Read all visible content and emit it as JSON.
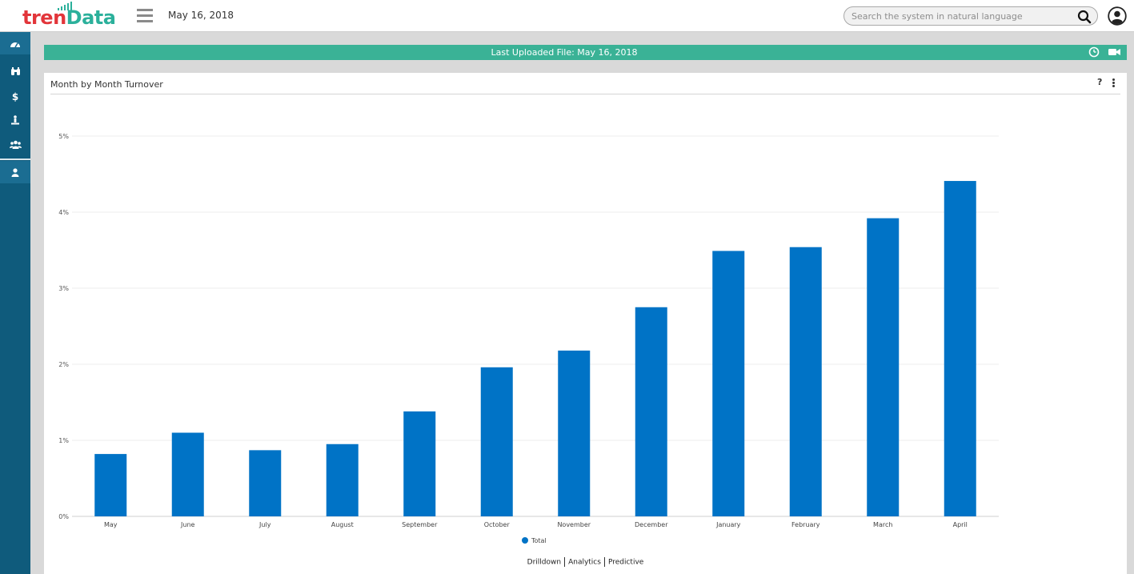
{
  "app": {
    "logo_part1": "tren",
    "logo_part2": "Data",
    "date": "May 16, 2018",
    "search_placeholder": "Search the system in natural language"
  },
  "sidebar": {
    "items": [
      {
        "icon": "dashboard-icon"
      },
      {
        "icon": "binoculars-icon"
      },
      {
        "icon": "dollar-icon"
      },
      {
        "icon": "person-stand-icon"
      },
      {
        "icon": "users-icon"
      },
      {
        "icon": "user-icon"
      }
    ]
  },
  "banner": {
    "text": "Last Uploaded File: May 16, 2018",
    "icons": [
      "clock-icon",
      "video-camera-icon"
    ]
  },
  "panel": {
    "title": "Month by Month Turnover",
    "help_label": "?"
  },
  "links": [
    "Drilldown",
    "Analytics",
    "Predictive"
  ],
  "colors": {
    "header_bg": "#ffffff",
    "sidebar_bg": "#0f5b7c",
    "banner_bg": "#3ab296",
    "bar": "#0073c6",
    "logo_red": "#e2353a",
    "logo_teal": "#2bb09b"
  },
  "chart_data": {
    "type": "bar",
    "categories": [
      "May",
      "June",
      "July",
      "August",
      "September",
      "October",
      "November",
      "December",
      "January",
      "February",
      "March",
      "April"
    ],
    "series": [
      {
        "name": "Total",
        "values": [
          0.82,
          1.1,
          0.87,
          0.95,
          1.38,
          1.96,
          2.18,
          2.75,
          3.49,
          3.54,
          3.92,
          4.41
        ]
      }
    ],
    "ylim": [
      0,
      5
    ],
    "yticks": [
      "0%",
      "1%",
      "2%",
      "3%",
      "4%",
      "5%"
    ],
    "grid": true,
    "legend": "bottom-center"
  }
}
